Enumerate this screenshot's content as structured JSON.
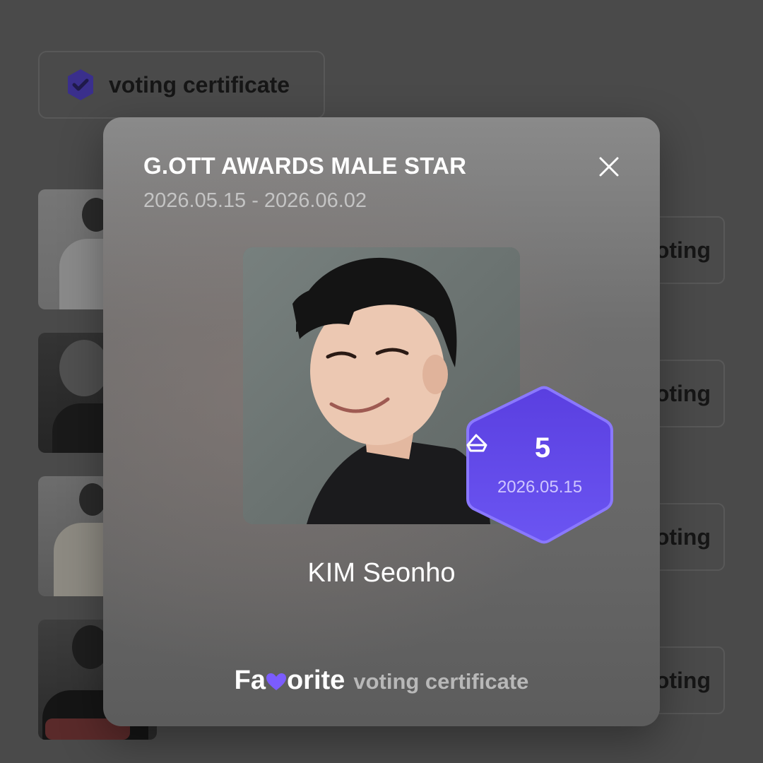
{
  "background": {
    "certificate_button": {
      "label": "voting certificate",
      "icon": "check-badge-icon"
    },
    "vote_button_label": "oting",
    "candidates": [
      {
        "photo": "candidate-photo"
      },
      {
        "photo": "candidate-photo"
      },
      {
        "photo": "candidate-photo"
      },
      {
        "photo": "candidate-photo"
      }
    ]
  },
  "modal": {
    "title": "G.OTT AWARDS MALE STAR",
    "period": "2026.05.15 - 2026.06.02",
    "close_icon": "close-icon",
    "candidate_name": "KIM Seonho",
    "vote_badge": {
      "icon": "ticket-icon",
      "count": "5",
      "date": "2026.05.15"
    },
    "footer": {
      "brand_prefix": "Fa",
      "brand_suffix": "orite",
      "subtitle": "voting certificate"
    }
  },
  "colors": {
    "accent": "#6a4cf0",
    "accent_dark": "#4a36b8",
    "overlay": "#4a4a4a"
  }
}
